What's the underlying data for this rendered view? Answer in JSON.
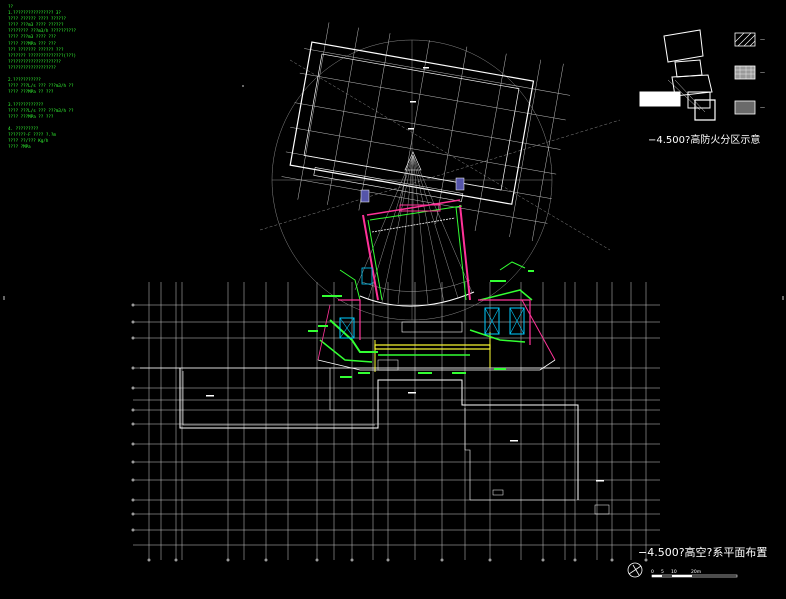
{
  "drawing": {
    "notes_header": "??",
    "notes": [
      "1.????????????????      3?",
      "  ????  ??????        ????  ??????",
      "  ????  ???m3          ????  ??????",
      "  ????????  ???m3/h    ??????????",
      "  ????  ???m3          ????  ???",
      "  ????  ???MPa         ???  ???",
      "  ???  ???????       ??????  ???",
      "  ???????  ??????????????(???)",
      "    ?????????????????????",
      "    ???????????????????",
      "",
      "2.???????????",
      "  ????  ???L/s    ???  ???m3/h  ??",
      "  ????  ???MPa    ??  ???",
      "",
      "3.????????????",
      "  ????  ???L/s    ???  ???m3/h  ??",
      "  ????  ???MPa    ??  ???",
      "",
      "4.  ?????????",
      "  ???????-F  ????  ?.?m",
      "  ????  ??/???  Kg/h",
      "  ????  ?MPa"
    ],
    "captions": {
      "fire_zone": "−4.500?高防火分区示意",
      "plan": "−4.500?高空?系平面布置"
    },
    "legend": {
      "items": [
        {
          "label": "—",
          "pattern": "hatch-dark"
        },
        {
          "label": "—",
          "pattern": "hatch-cross"
        },
        {
          "label": "—",
          "pattern": "hatch-light"
        }
      ]
    },
    "scale_bar": {
      "labels": [
        "0",
        "5",
        "10",
        "20m"
      ]
    },
    "colors": {
      "background": "#000000",
      "lines": "#ffffff",
      "annotation": "#33ff33",
      "wall": "#ff3399",
      "equipment": "#00ccff",
      "duct": "#ffff33"
    }
  }
}
